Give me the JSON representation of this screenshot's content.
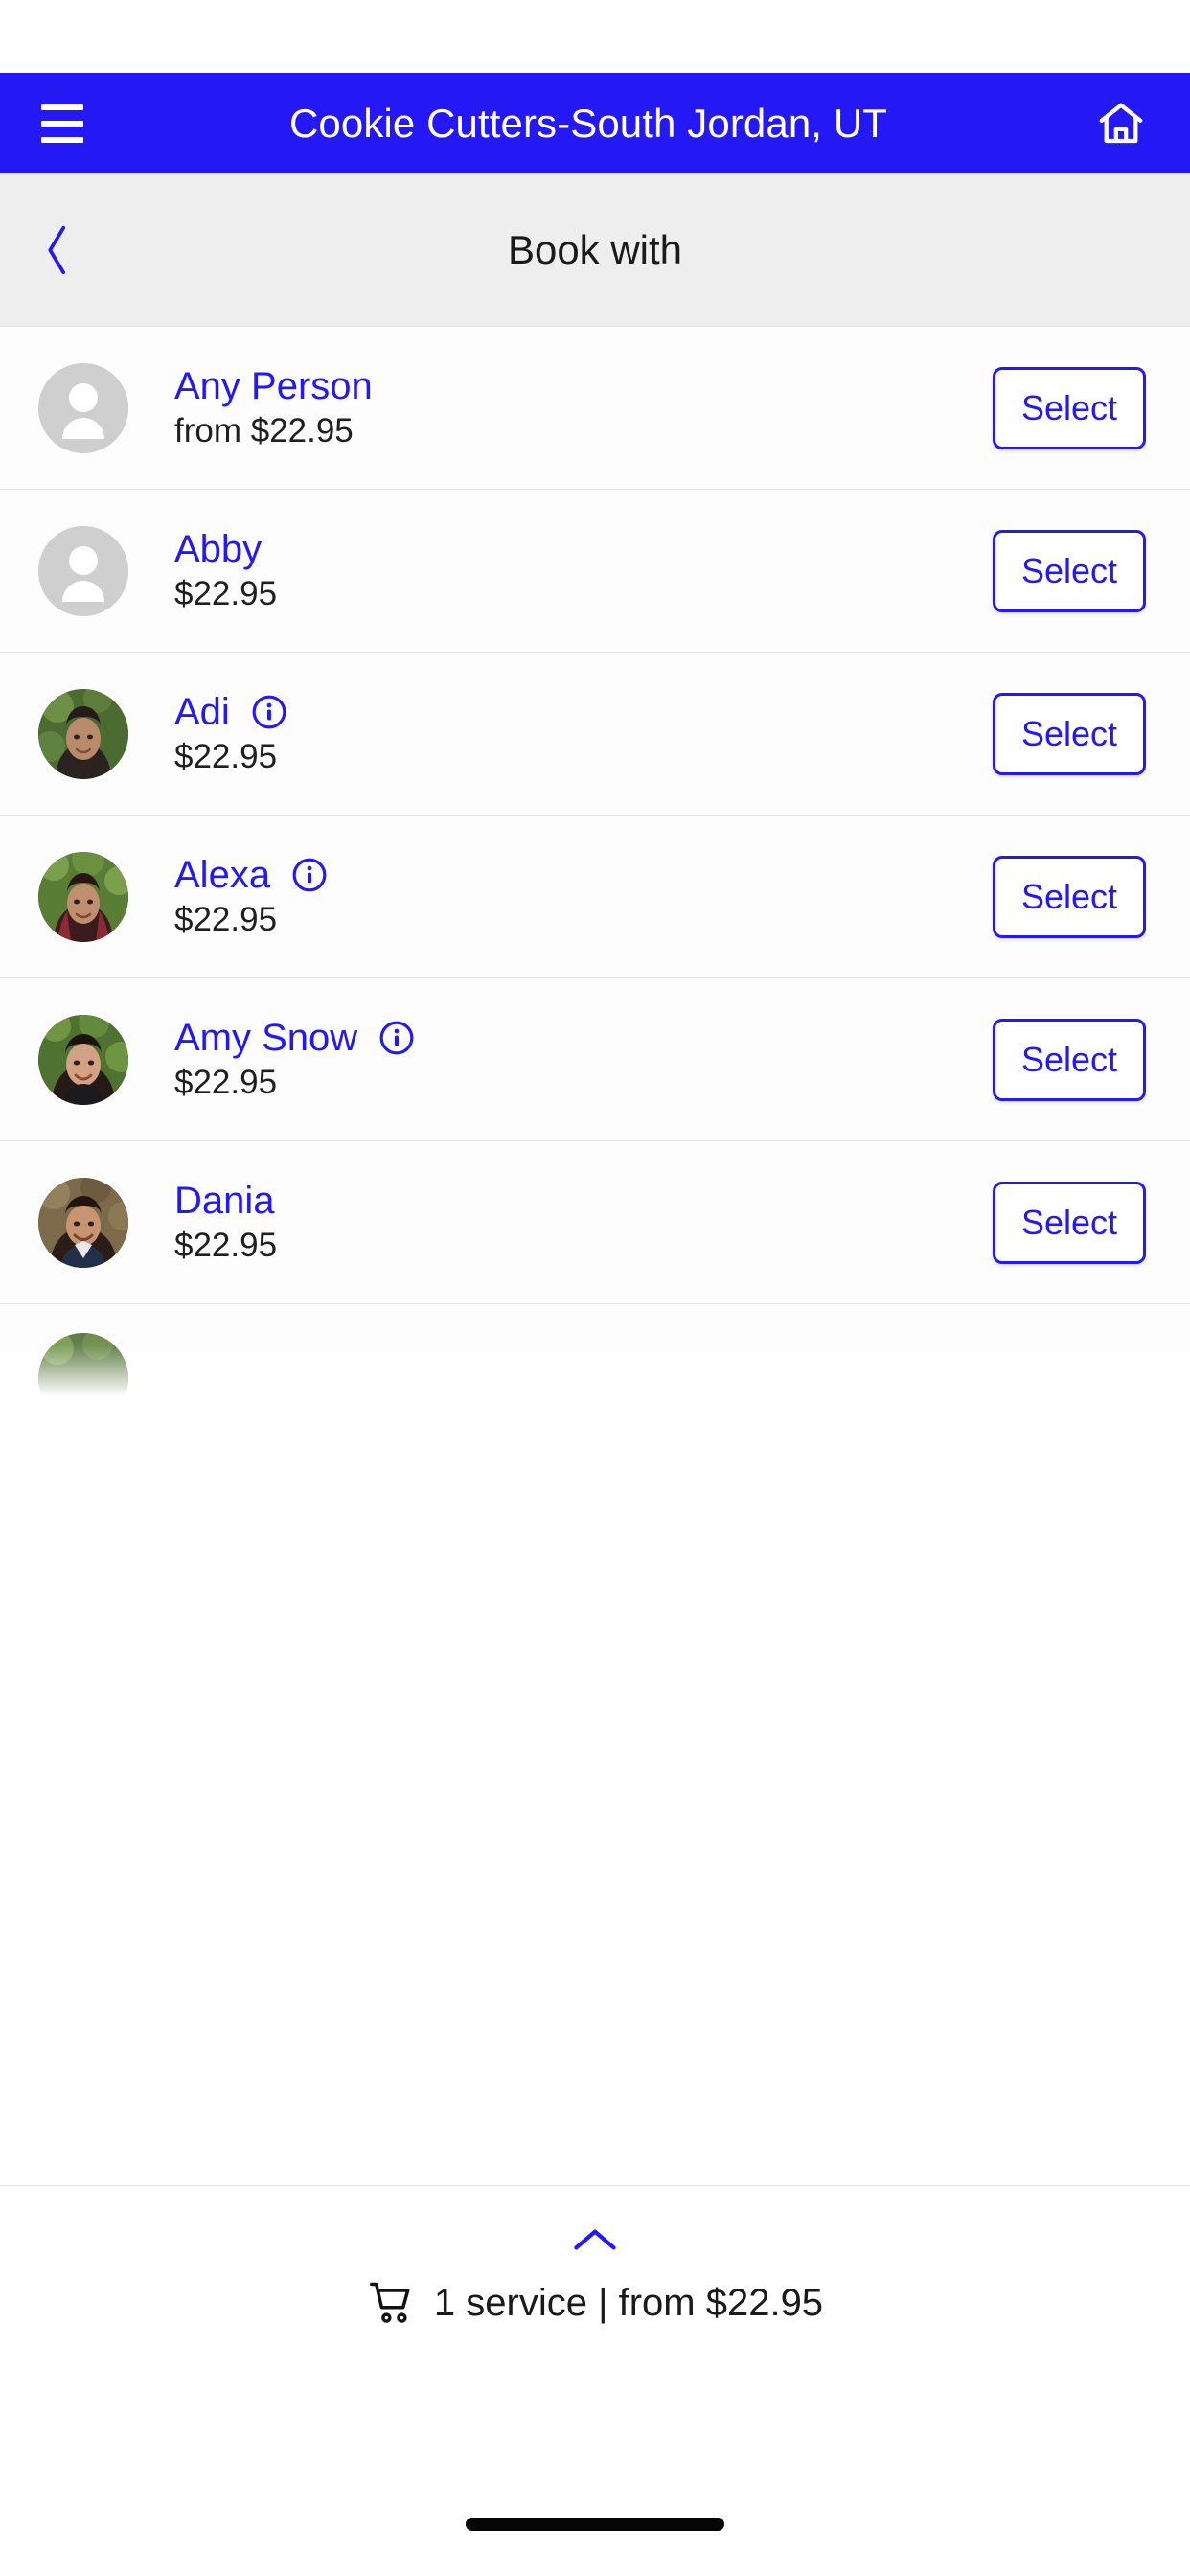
{
  "appbar": {
    "title": "Cookie Cutters-South Jordan, UT",
    "menu_icon": "hamburger-menu-icon",
    "home_icon": "home-icon",
    "background_color": "#2419F5"
  },
  "subheader": {
    "title": "Book with",
    "back_icon": "chevron-left-icon",
    "background_color": "#EEEEEE"
  },
  "list": {
    "select_label": "Select",
    "info_icon": "info-circle-icon",
    "items": [
      {
        "name": "Any Person",
        "price": "from $22.95",
        "avatar": "placeholder-person-icon",
        "has_info": false,
        "select_label": "Select"
      },
      {
        "name": "Abby",
        "price": "$22.95",
        "avatar": "placeholder-person-icon",
        "has_info": false,
        "select_label": "Select"
      },
      {
        "name": "Adi",
        "price": "$22.95",
        "avatar": "photo",
        "has_info": true,
        "select_label": "Select"
      },
      {
        "name": "Alexa",
        "price": "$22.95",
        "avatar": "photo",
        "has_info": true,
        "select_label": "Select"
      },
      {
        "name": "Amy Snow",
        "price": "$22.95",
        "avatar": "photo",
        "has_info": true,
        "select_label": "Select"
      },
      {
        "name": "Dania",
        "price": "$22.95",
        "avatar": "photo",
        "has_info": false,
        "select_label": "Select"
      }
    ]
  },
  "bottom_bar": {
    "expand_icon": "chevron-up-icon",
    "cart_icon": "shopping-cart-icon",
    "summary": "1 service  |  from $22.95",
    "service_count": "1 service",
    "price": "from $22.95"
  },
  "colors": {
    "brand_blue": "#2419F5",
    "link_blue": "#2419F5",
    "subheader_gray": "#EEEEEE",
    "text_dark": "#1A1A1A"
  }
}
